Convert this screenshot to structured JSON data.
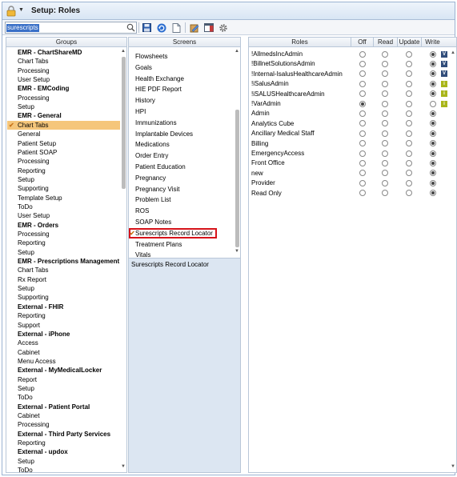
{
  "title": "Setup: Roles",
  "search": {
    "value": "surescripts"
  },
  "groups": {
    "header": "Groups",
    "items": [
      {
        "label": "EMR - ChartShareMD",
        "bold": true
      },
      {
        "label": "Chart Tabs"
      },
      {
        "label": "Processing"
      },
      {
        "label": "User Setup"
      },
      {
        "label": "EMR - EMCoding",
        "bold": true
      },
      {
        "label": "Processing"
      },
      {
        "label": "Setup"
      },
      {
        "label": "EMR - General",
        "bold": true
      },
      {
        "label": "Chart Tabs",
        "selected": true
      },
      {
        "label": "General"
      },
      {
        "label": "Patient Setup"
      },
      {
        "label": "Patient SOAP"
      },
      {
        "label": "Processing"
      },
      {
        "label": "Reporting"
      },
      {
        "label": "Setup"
      },
      {
        "label": "Supporting"
      },
      {
        "label": "Template Setup"
      },
      {
        "label": "ToDo"
      },
      {
        "label": "User Setup"
      },
      {
        "label": "EMR - Orders",
        "bold": true
      },
      {
        "label": "Processing"
      },
      {
        "label": "Reporting"
      },
      {
        "label": "Setup"
      },
      {
        "label": "EMR - Prescriptions Management",
        "bold": true
      },
      {
        "label": "Chart Tabs"
      },
      {
        "label": "Rx Report"
      },
      {
        "label": "Setup"
      },
      {
        "label": "Supporting"
      },
      {
        "label": "External - FHIR",
        "bold": true
      },
      {
        "label": "Reporting"
      },
      {
        "label": "Support"
      },
      {
        "label": "External - iPhone",
        "bold": true
      },
      {
        "label": "Access"
      },
      {
        "label": "Cabinet"
      },
      {
        "label": "Menu Access"
      },
      {
        "label": "External - MyMedicalLocker",
        "bold": true
      },
      {
        "label": "Report"
      },
      {
        "label": "Setup"
      },
      {
        "label": "ToDo"
      },
      {
        "label": "External - Patient Portal",
        "bold": true
      },
      {
        "label": "Cabinet"
      },
      {
        "label": "Processing"
      },
      {
        "label": "External - Third Party Services",
        "bold": true
      },
      {
        "label": "Reporting"
      },
      {
        "label": "External - updox",
        "bold": true
      },
      {
        "label": "Setup"
      },
      {
        "label": "ToDo"
      }
    ]
  },
  "screens": {
    "header": "Screens",
    "items": [
      {
        "label": "Flowsheets"
      },
      {
        "label": "Goals"
      },
      {
        "label": "Health Exchange"
      },
      {
        "label": "HIE PDF Report"
      },
      {
        "label": "History"
      },
      {
        "label": "HPI"
      },
      {
        "label": "Immunizations"
      },
      {
        "label": "Implantable Devices"
      },
      {
        "label": "Medications"
      },
      {
        "label": "Order Entry"
      },
      {
        "label": "Patient Education"
      },
      {
        "label": "Pregnancy"
      },
      {
        "label": "Pregnancy Visit"
      },
      {
        "label": "Problem List"
      },
      {
        "label": "ROS"
      },
      {
        "label": "SOAP Notes"
      },
      {
        "label": "Surescripts Record Locator",
        "selected": true
      },
      {
        "label": "Treatment Plans"
      },
      {
        "label": "Vitals"
      }
    ],
    "detail": "Surescripts Record Locator"
  },
  "roles": {
    "headers": {
      "roles": "Roles",
      "off": "Off",
      "read": "Read",
      "update": "Update",
      "write": "Write"
    },
    "items": [
      {
        "label": "!AllmedsIncAdmin",
        "value": "write",
        "badge": "V"
      },
      {
        "label": "!BillnetSolutionsAdmin",
        "value": "write",
        "badge": "V"
      },
      {
        "label": "!Internal-IsalusHealthcareAdmin",
        "value": "write",
        "badge": "V"
      },
      {
        "label": "!iSalusAdmin",
        "value": "write",
        "badge": "i"
      },
      {
        "label": "!iSALUSHealthcareAdmin",
        "value": "write",
        "badge": "i"
      },
      {
        "label": "!VarAdmin",
        "value": "off",
        "badge": "i"
      },
      {
        "label": "Admin",
        "value": "write"
      },
      {
        "label": "Analytics Cube",
        "value": "write"
      },
      {
        "label": "Ancillary Medical Staff",
        "value": "write"
      },
      {
        "label": "Billing",
        "value": "write"
      },
      {
        "label": "EmergencyAccess",
        "value": "write"
      },
      {
        "label": "Front Office",
        "value": "write"
      },
      {
        "label": "new",
        "value": "write"
      },
      {
        "label": "Provider",
        "value": "write"
      },
      {
        "label": "Read Only",
        "value": "write"
      }
    ]
  },
  "colors": {
    "selection": "#f5c67b",
    "highlight_box": "#d6131a",
    "badge_v": "#314d7a",
    "badge_i": "#a9b51a"
  },
  "icons": [
    "lock-icon",
    "search-icon",
    "save-icon",
    "refresh-icon",
    "new-document-icon",
    "edit-icon",
    "panel-icon",
    "gear-icon",
    "checkmark-icon"
  ]
}
